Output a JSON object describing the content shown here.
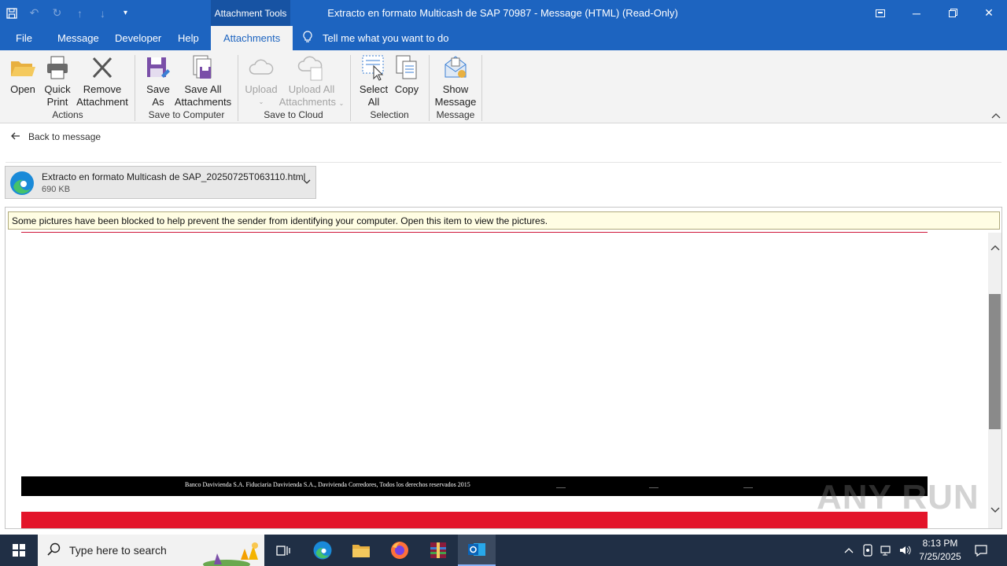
{
  "window": {
    "title": "Extracto en formato Multicash de SAP 70987  -  Message (HTML) (Read-Only)",
    "context_tab_group": "Attachment Tools"
  },
  "tabs": [
    {
      "label": "File"
    },
    {
      "label": "Message"
    },
    {
      "label": "Developer"
    },
    {
      "label": "Help"
    },
    {
      "label": "Attachments",
      "active": true
    }
  ],
  "tell_me": "Tell me what you want to do",
  "ribbon": {
    "open": "Open",
    "quick_print_1": "Quick",
    "quick_print_2": "Print",
    "remove_1": "Remove",
    "remove_2": "Attachment",
    "save_as_1": "Save",
    "save_as_2": "As",
    "save_all_1": "Save All",
    "save_all_2": "Attachments",
    "upload": "Upload",
    "upload_all_1": "Upload All",
    "upload_all_2": "Attachments",
    "select_all_1": "Select",
    "select_all_2": "All",
    "copy": "Copy",
    "show_message_1": "Show",
    "show_message_2": "Message",
    "groups": {
      "actions": "Actions",
      "save_to_computer": "Save to Computer",
      "save_to_cloud": "Save to Cloud",
      "selection": "Selection",
      "message": "Message"
    }
  },
  "back_link": "Back to message",
  "attachment": {
    "filename": "Extracto en formato Multicash de SAP_20250725T063110.html",
    "size": "690 KB"
  },
  "infobar": "Some pictures have been blocked to help prevent the sender from identifying your computer. Open this item to view the pictures.",
  "email_footer": "Banco Davivienda S.A. Fiduciaria Davivienda S.A., Davivienda Corredores, Todos los derechos reservados 2015",
  "watermark": "ANY RUN",
  "taskbar": {
    "search_placeholder": "Type here to search",
    "time": "8:13 PM",
    "date": "7/25/2025"
  },
  "colors": {
    "accent": "#1d64c0",
    "footer_red": "#e3152a",
    "taskbar": "#202f45"
  }
}
